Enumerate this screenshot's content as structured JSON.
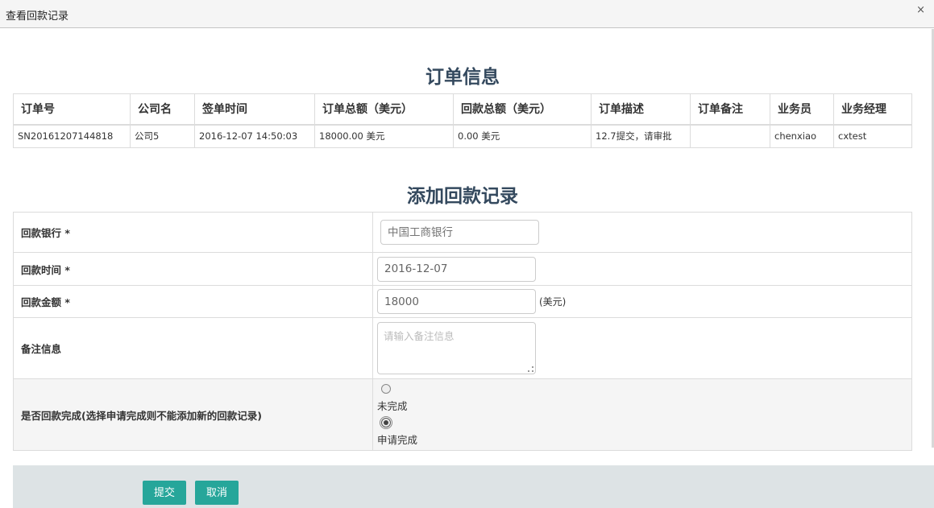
{
  "dialog": {
    "title": "查看回款记录",
    "close_glyph": "×"
  },
  "order_section": {
    "title": "订单信息",
    "columns": [
      "订单号",
      "公司名",
      "签单时间",
      "订单总额（美元）",
      "回款总额（美元）",
      "订单描述",
      "订单备注",
      "业务员",
      "业务经理"
    ],
    "rows": [
      [
        "SN20161207144818",
        "公司5",
        "2016-12-07 14:50:03",
        "18000.00 美元",
        "0.00 美元",
        "12.7提交，请审批",
        "",
        "chenxiao",
        "cxtest"
      ]
    ]
  },
  "form_section": {
    "title": "添加回款记录",
    "bank": {
      "label": "回款银行 *",
      "placeholder": "中国工商银行"
    },
    "date": {
      "label": "回款时间 *",
      "value": "2016-12-07"
    },
    "amount": {
      "label": "回款金额 *",
      "value": "18000",
      "unit": "(美元)"
    },
    "note": {
      "label": "备注信息",
      "placeholder": "请输入备注信息"
    },
    "complete": {
      "label": "是否回款完成(选择申请完成则不能添加新的回款记录)",
      "options": [
        {
          "label": "未完成",
          "checked": false
        },
        {
          "label": "申请完成",
          "checked": true
        }
      ]
    }
  },
  "footer": {
    "submit_label": "提交",
    "cancel_label": "取消"
  },
  "colors": {
    "accent": "#26a69a",
    "heading": "#34495e",
    "footer_bg": "#dde3e5"
  }
}
